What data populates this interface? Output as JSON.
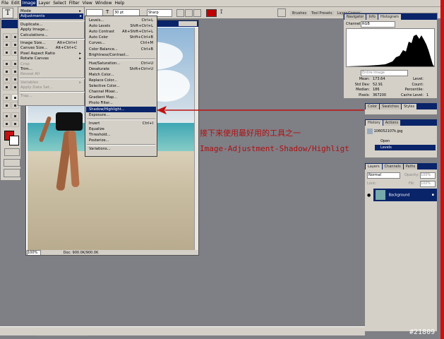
{
  "menubar": [
    "File",
    "Edit",
    "Image",
    "Layer",
    "Select",
    "Filter",
    "View",
    "Window",
    "Help"
  ],
  "options": {
    "size": "30 pt",
    "antialias": "Sharp",
    "font_box": "",
    "color": "#c00000"
  },
  "palette_tabs": [
    "Brushes",
    "Tool Presets",
    "Layer Comps"
  ],
  "image_menu": [
    {
      "label": "Mode",
      "sub": true
    },
    {
      "label": "Adjustments",
      "sub": true,
      "selected": true
    },
    {
      "sep": true
    },
    {
      "label": "Duplicate..."
    },
    {
      "label": "Apply Image..."
    },
    {
      "label": "Calculations..."
    },
    {
      "sep": true
    },
    {
      "label": "Image Size...",
      "shortcut": "Alt+Ctrl+I"
    },
    {
      "label": "Canvas Size...",
      "shortcut": "Alt+Ctrl+C"
    },
    {
      "label": "Pixel Aspect Ratio",
      "sub": true
    },
    {
      "label": "Rotate Canvas",
      "sub": true
    },
    {
      "label": "Crop",
      "disabled": true
    },
    {
      "label": "Trim..."
    },
    {
      "label": "Reveal All",
      "disabled": true
    },
    {
      "sep": true
    },
    {
      "label": "Variables",
      "sub": true,
      "disabled": true
    },
    {
      "label": "Apply Data Set...",
      "disabled": true
    },
    {
      "sep": true
    },
    {
      "label": "Trap...",
      "disabled": true
    }
  ],
  "adjust_menu": [
    {
      "label": "Levels...",
      "shortcut": "Ctrl+L"
    },
    {
      "label": "Auto Levels",
      "shortcut": "Shift+Ctrl+L"
    },
    {
      "label": "Auto Contrast",
      "shortcut": "Alt+Shift+Ctrl+L"
    },
    {
      "label": "Auto Color",
      "shortcut": "Shift+Ctrl+B"
    },
    {
      "label": "Curves...",
      "shortcut": "Ctrl+M"
    },
    {
      "label": "Color Balance...",
      "shortcut": "Ctrl+B"
    },
    {
      "label": "Brightness/Contrast..."
    },
    {
      "sep": true
    },
    {
      "label": "Hue/Saturation...",
      "shortcut": "Ctrl+U"
    },
    {
      "label": "Desaturate",
      "shortcut": "Shift+Ctrl+U"
    },
    {
      "label": "Match Color..."
    },
    {
      "label": "Replace Color..."
    },
    {
      "label": "Selective Color..."
    },
    {
      "label": "Channel Mixer..."
    },
    {
      "label": "Gradient Map..."
    },
    {
      "label": "Photo Filter..."
    },
    {
      "label": "Shadow/Highlight...",
      "selected": true
    },
    {
      "label": "Exposure..."
    },
    {
      "sep": true
    },
    {
      "label": "Invert",
      "shortcut": "Ctrl+I"
    },
    {
      "label": "Equalize"
    },
    {
      "label": "Threshold..."
    },
    {
      "label": "Posterize..."
    },
    {
      "sep": true
    },
    {
      "label": "Variations..."
    }
  ],
  "annotation": {
    "line1": "接下来使用最好用的工具之一",
    "line2": "Image-Adjustment-Shadow/Highligt"
  },
  "navigator": {
    "tabs": [
      "Navigator",
      "Info",
      "Histogram"
    ],
    "channel_label": "Channel:",
    "channel_value": "RGB",
    "source": "Entire Image",
    "stats": [
      {
        "k": "Mean:",
        "v": "173.64"
      },
      {
        "k": "Std Dev:",
        "v": "52.91"
      },
      {
        "k": "Median:",
        "v": "186"
      },
      {
        "k": "Pixels:",
        "v": "367200"
      }
    ],
    "stats2": [
      {
        "k": "Level:",
        "v": ""
      },
      {
        "k": "Count:",
        "v": ""
      },
      {
        "k": "Percentile:",
        "v": ""
      },
      {
        "k": "Cache Level:",
        "v": "1"
      }
    ]
  },
  "color_tabs": [
    "Color",
    "Swatches",
    "Styles"
  ],
  "history": {
    "tabs": [
      "History",
      "Actions"
    ],
    "snapshot": "106052107k.jpg",
    "items": [
      {
        "label": "Open"
      },
      {
        "label": "Levels",
        "selected": true
      }
    ]
  },
  "layers": {
    "tabs": [
      "Layers",
      "Channels",
      "Paths"
    ],
    "blend": "Normal",
    "opacity_label": "Opacity:",
    "opacity": "100%",
    "lock_label": "Lock:",
    "fill_label": "Fill:",
    "fill": "100%",
    "layer": "Background"
  },
  "document": {
    "zoom": "100%",
    "doc_info": "Doc: 900.0K/900.0K"
  },
  "watermark": "#21809"
}
